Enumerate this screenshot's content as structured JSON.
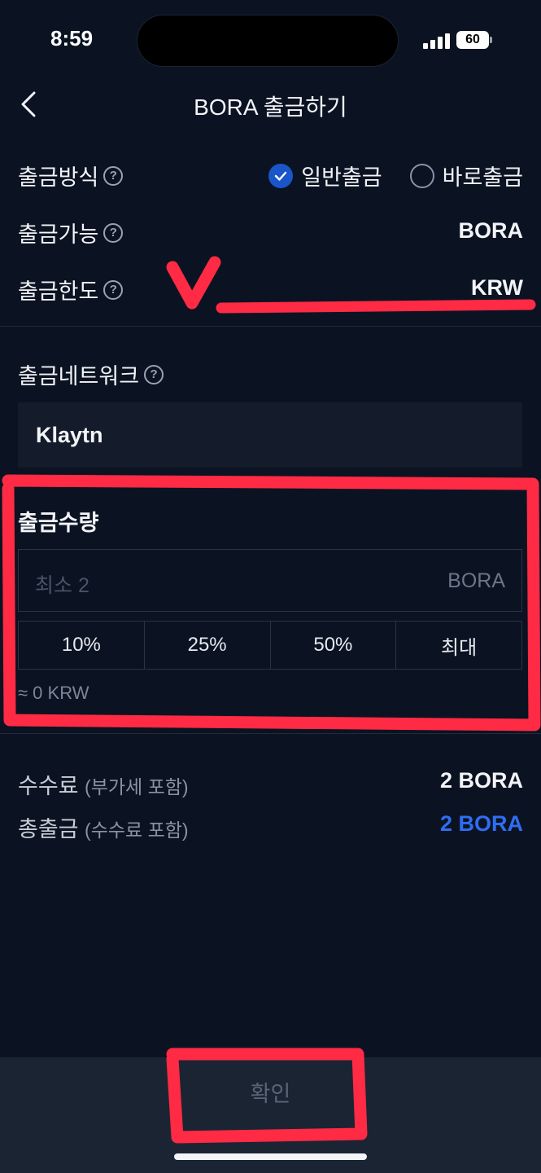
{
  "status_bar": {
    "time": "8:59",
    "battery": "60"
  },
  "header": {
    "title": "BORA 출금하기"
  },
  "withdraw_method": {
    "label": "출금방식",
    "options": [
      {
        "label": "일반출금",
        "selected": true
      },
      {
        "label": "바로출금",
        "selected": false
      }
    ]
  },
  "withdraw_available": {
    "label": "출금가능",
    "value": "BORA"
  },
  "withdraw_limit": {
    "label": "출금한도",
    "value": "KRW"
  },
  "network": {
    "label": "출금네트워크",
    "value": "Klaytn"
  },
  "quantity": {
    "label": "출금수량",
    "placeholder": "최소 2",
    "unit": "BORA",
    "percent_buttons": [
      "10%",
      "25%",
      "50%",
      "최대"
    ],
    "approx": "≈ 0 KRW"
  },
  "fee": {
    "label": "수수료",
    "note": "(부가세 포함)",
    "value": "2 BORA"
  },
  "total": {
    "label": "총출금",
    "note": "(수수료 포함)",
    "value": "2 BORA"
  },
  "confirm": {
    "label": "확인"
  },
  "colors": {
    "accent": "#1a56c9",
    "total_value": "#2f6df2",
    "annotation": "#ff2a44"
  }
}
